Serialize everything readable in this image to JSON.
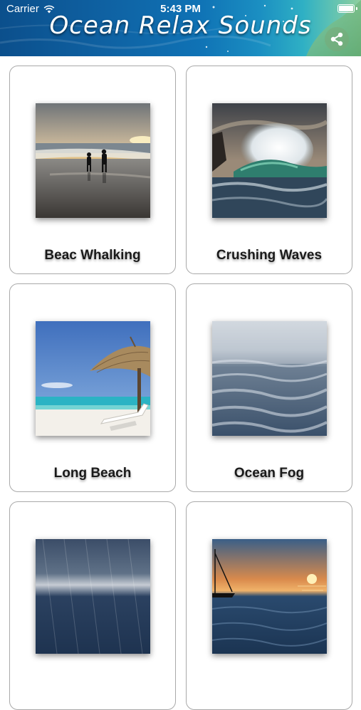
{
  "status_bar": {
    "carrier": "Carrier",
    "time": "5:43 PM"
  },
  "header": {
    "title": "Ocean Relax Sounds",
    "share_icon": "share-icon"
  },
  "cards": [
    {
      "label": "Beac Whalking",
      "image": "beach-walking-sunset"
    },
    {
      "label": "Crushing Waves",
      "image": "crashing-wave"
    },
    {
      "label": "Long Beach",
      "image": "beach-umbrella"
    },
    {
      "label": "Ocean Fog",
      "image": "foggy-sea"
    },
    {
      "label": "",
      "image": "stormy-sea-rain"
    },
    {
      "label": "",
      "image": "sailboat-sunset"
    }
  ]
}
